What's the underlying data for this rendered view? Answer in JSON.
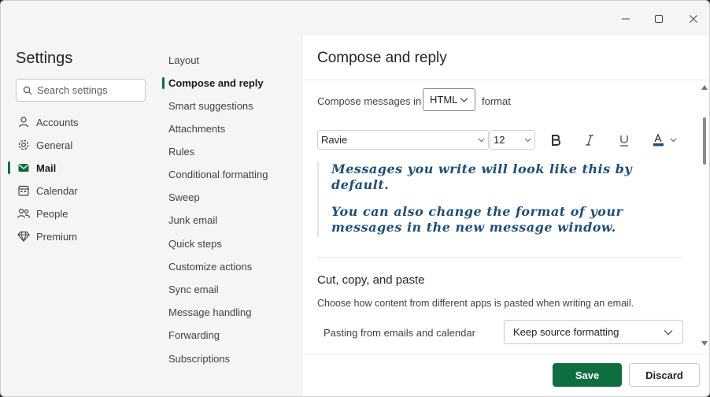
{
  "window": {
    "controls": [
      "minimize",
      "maximize",
      "close"
    ]
  },
  "sidebar": {
    "title": "Settings",
    "search_placeholder": "Search settings",
    "items": [
      {
        "label": "Accounts",
        "icon": "person-icon"
      },
      {
        "label": "General",
        "icon": "gear-icon"
      },
      {
        "label": "Mail",
        "icon": "mail-icon",
        "active": true
      },
      {
        "label": "Calendar",
        "icon": "calendar-icon"
      },
      {
        "label": "People",
        "icon": "people-icon"
      },
      {
        "label": "Premium",
        "icon": "diamond-icon"
      }
    ]
  },
  "submenu": {
    "items": [
      "Layout",
      "Compose and reply",
      "Smart suggestions",
      "Attachments",
      "Rules",
      "Conditional formatting",
      "Sweep",
      "Junk email",
      "Quick steps",
      "Customize actions",
      "Sync email",
      "Message handling",
      "Forwarding",
      "Subscriptions"
    ],
    "active_index": 1
  },
  "pane": {
    "title": "Compose and reply",
    "compose_label": "Compose messages in",
    "compose_format": "HTML",
    "format_suffix": "format",
    "font_name": "Ravie",
    "font_size": "12",
    "preview_line1": "Messages you write will look like this by default.",
    "preview_line2": "You can also change the format of your messages in the new message window.",
    "section_title": "Cut, copy, and paste",
    "section_desc": "Choose how content from different apps is pasted when writing an email.",
    "paste_label": "Pasting from emails and calendar",
    "paste_value": "Keep source formatting"
  },
  "footer": {
    "save_label": "Save",
    "discard_label": "Discard"
  },
  "colors": {
    "accent": "#0f6e3f",
    "preview_text": "#1f4e79",
    "font_color_bar": "#1f4e79"
  }
}
